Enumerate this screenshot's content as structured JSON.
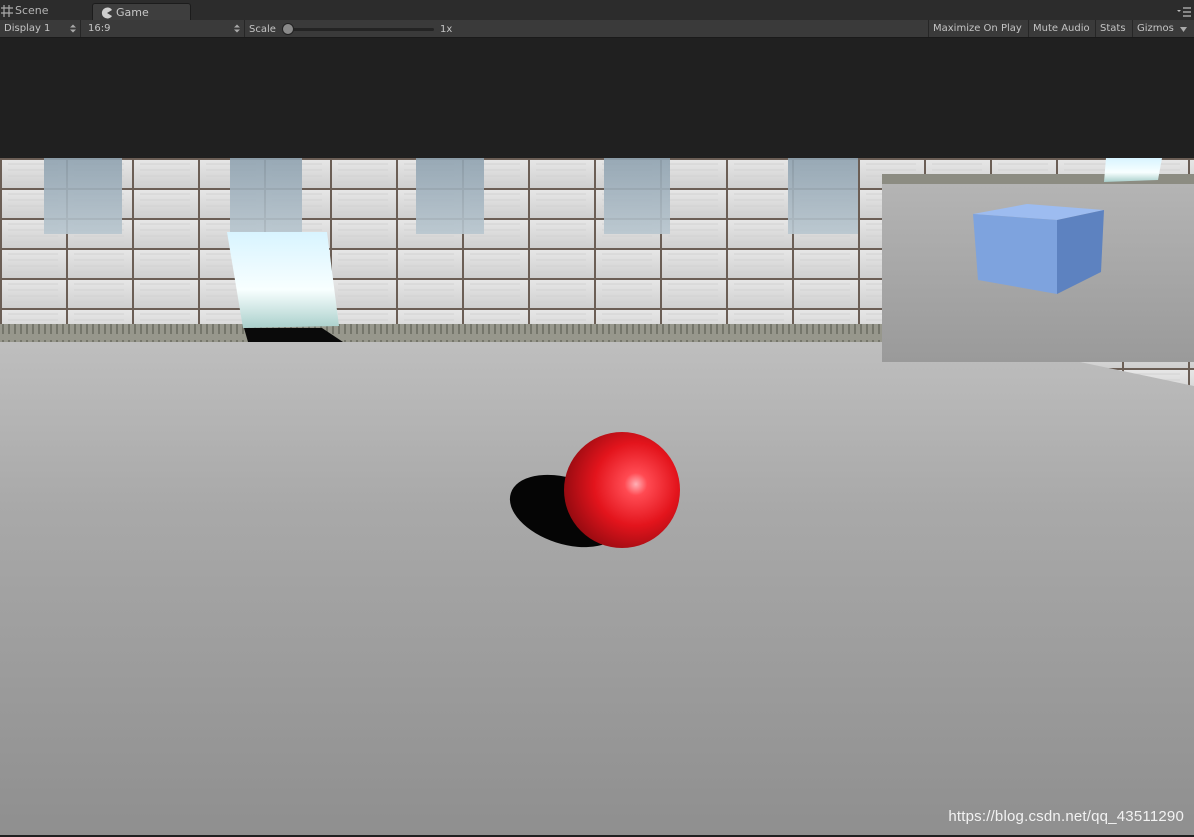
{
  "tabs": {
    "scene": {
      "label": "Scene",
      "icon": "grid-icon"
    },
    "game": {
      "label": "Game",
      "icon": "pacman-icon"
    },
    "menu_icon": "panel-menu-icon"
  },
  "toolbar": {
    "display": "Display 1",
    "aspect": "16:9",
    "scale_label": "Scale",
    "scale_value": "1x",
    "scale_level": 0,
    "maximize_on_play": "Maximize On Play",
    "mute_audio": "Mute Audio",
    "stats": "Stats",
    "gizmos": "Gizmos"
  },
  "scene": {
    "sphere_color": "#e8141c",
    "cube_color": "#7ea3de",
    "floor_color": "#a4a4a4",
    "minimap": "secondary-camera-view"
  },
  "watermark": "https://blog.csdn.net/qq_43511290",
  "colors": {
    "editor_bg": "#202020",
    "toolbar_bg": "#3a3a3a",
    "text": "#c4c4c4"
  }
}
